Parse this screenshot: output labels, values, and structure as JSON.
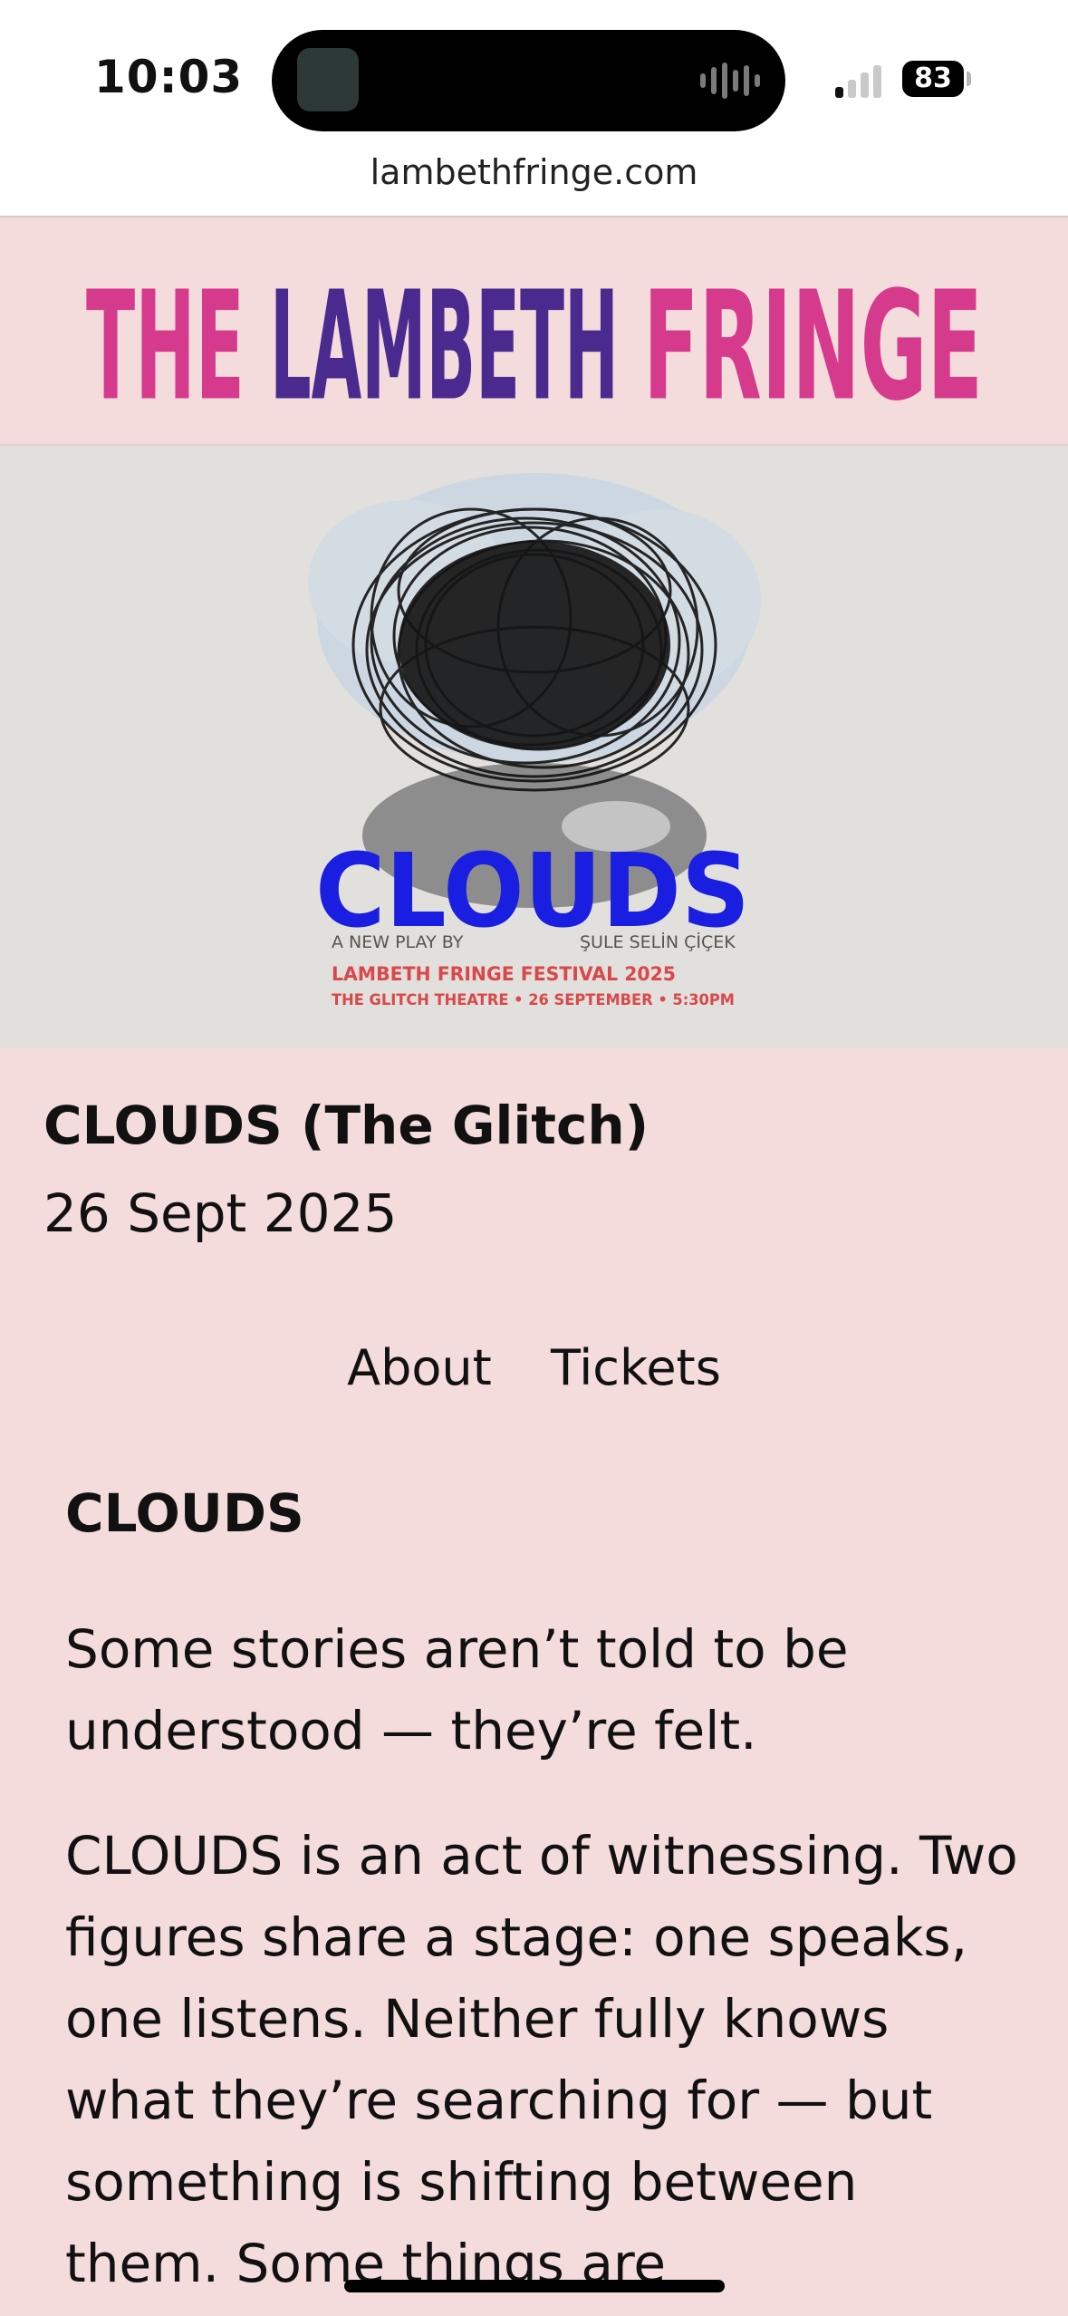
{
  "status_bar": {
    "time": "10:03",
    "battery": "83"
  },
  "browser": {
    "url": "lambethfringe.com"
  },
  "logo": {
    "word1": "THE",
    "word2": "LAMBETH",
    "word3": "FRINGE"
  },
  "poster": {
    "title": "CLOUDS",
    "credit_left": "A NEW PLAY BY",
    "credit_right": "ŞULE SELİN ÇİÇEK",
    "festival": "LAMBETH FRINGE FESTIVAL 2025",
    "venue_line": "THE GLITCH  THEATRE • 26 SEPTEMBER • 5:30PM"
  },
  "event": {
    "title": "CLOUDS (The Glitch)",
    "date": "26 Sept 2025"
  },
  "nav": {
    "about": "About",
    "tickets": "Tickets"
  },
  "content": {
    "heading": "CLOUDS",
    "paragraph1": "Some stories aren’t told to be understood — they’re felt.",
    "paragraph2": "CLOUDS is an act of witnessing. Two figures share a stage: one speaks, one listens. Neither fully knows what they’re searching for — but something is shifting between them. Some things are"
  },
  "colors": {
    "page_bg": "#f3dcdb",
    "logo_pink": "#d63a8c",
    "logo_purple": "#4b2a8f",
    "poster_blue": "#1a1ee0",
    "poster_red": "#d9484a"
  }
}
